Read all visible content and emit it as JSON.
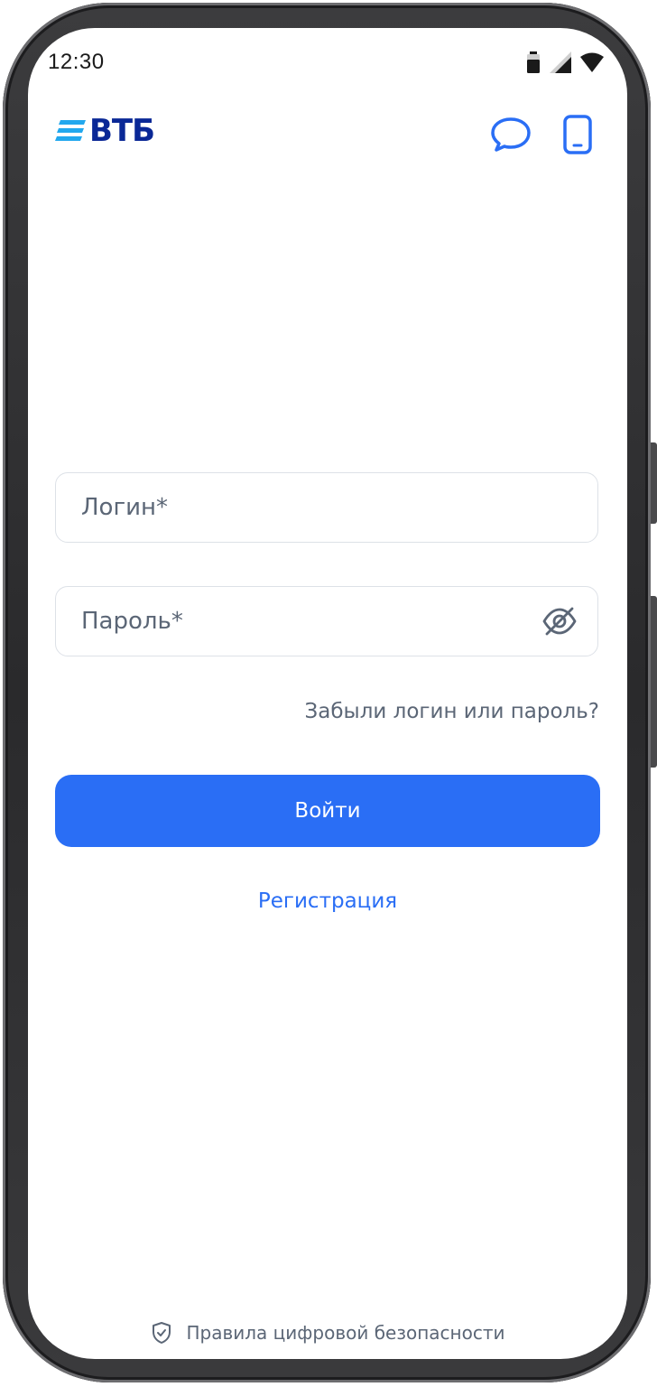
{
  "status_bar": {
    "time": "12:30",
    "icons": [
      "battery-icon",
      "cellular-signal-icon",
      "wifi-icon"
    ]
  },
  "header": {
    "logo_text": "ВТБ",
    "chat_icon": "chat-bubble-icon",
    "phone_icon": "mobile-phone-icon"
  },
  "form": {
    "login_placeholder": "Логин*",
    "login_value": "",
    "password_placeholder": "Пароль*",
    "password_value": "",
    "password_toggle_icon": "eye-off-icon",
    "forgot_link": "Забыли логин или пароль?",
    "submit_label": "Войти",
    "register_link": "Регистрация"
  },
  "footer": {
    "icon": "shield-check-icon",
    "text": "Правила цифровой безопасности"
  },
  "colors": {
    "primary": "#2a6ef5",
    "logo_blue": "#0a2896",
    "logo_accent": "#22a8ee",
    "muted_text": "#5b6676",
    "field_border": "#dde1e7"
  }
}
